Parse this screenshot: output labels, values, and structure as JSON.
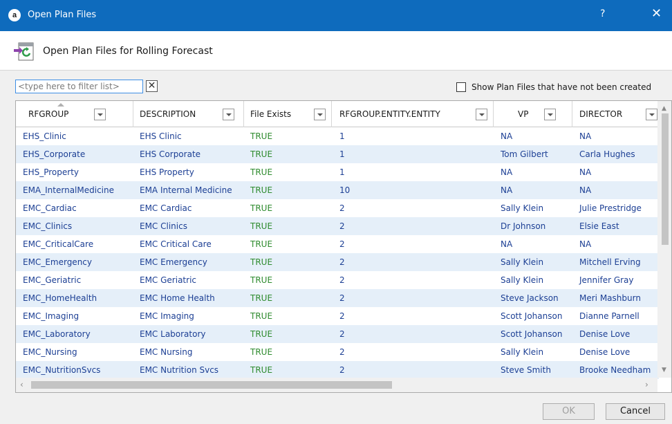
{
  "window": {
    "title": "Open Plan Files",
    "app_icon_glyph": "a",
    "help_label": "?",
    "close_label": "✕"
  },
  "header": {
    "title": "Open Plan Files for Rolling Forecast",
    "icon": "refresh-import-icon"
  },
  "filter": {
    "placeholder": "<type here to filter list>",
    "clear_label": "✕"
  },
  "show_uncreated": {
    "label": "Show Plan Files that have not been created",
    "checked": false
  },
  "grid": {
    "columns": [
      "RFGROUP",
      "DESCRIPTION",
      "File Exists",
      "RFGROUP.ENTITY.ENTITY",
      "VP",
      "DIRECTOR"
    ],
    "sorted_column": "RFGROUP",
    "rows": [
      [
        "EHS_Clinic",
        "EHS Clinic",
        "TRUE",
        "1",
        "NA",
        "NA"
      ],
      [
        "EHS_Corporate",
        "EHS Corporate",
        "TRUE",
        "1",
        "Tom Gilbert",
        "Carla Hughes"
      ],
      [
        "EHS_Property",
        "EHS Property",
        "TRUE",
        "1",
        "NA",
        "NA"
      ],
      [
        "EMA_InternalMedicine",
        "EMA Internal Medicine",
        "TRUE",
        "10",
        "NA",
        "NA"
      ],
      [
        "EMC_Cardiac",
        "EMC Cardiac",
        "TRUE",
        "2",
        "Sally Klein",
        "Julie Prestridge"
      ],
      [
        "EMC_Clinics",
        "EMC Clinics",
        "TRUE",
        "2",
        "Dr Johnson",
        "Elsie East"
      ],
      [
        "EMC_CriticalCare",
        "EMC Critical Care",
        "TRUE",
        "2",
        "NA",
        "NA"
      ],
      [
        "EMC_Emergency",
        "EMC Emergency",
        "TRUE",
        "2",
        "Sally Klein",
        "Mitchell Erving"
      ],
      [
        "EMC_Geriatric",
        "EMC Geriatric",
        "TRUE",
        "2",
        "Sally Klein",
        "Jennifer Gray"
      ],
      [
        "EMC_HomeHealth",
        "EMC Home Health",
        "TRUE",
        "2",
        "Steve Jackson",
        "Meri Mashburn"
      ],
      [
        "EMC_Imaging",
        "EMC Imaging",
        "TRUE",
        "2",
        "Scott Johanson",
        "Dianne Parnell"
      ],
      [
        "EMC_Laboratory",
        "EMC Laboratory",
        "TRUE",
        "2",
        "Scott Johanson",
        "Denise Love"
      ],
      [
        "EMC_Nursing",
        "EMC Nursing",
        "TRUE",
        "2",
        "Sally Klein",
        "Denise Love"
      ],
      [
        "EMC_NutritionSvcs",
        "EMC Nutrition Svcs",
        "TRUE",
        "2",
        "Steve Smith",
        "Brooke Needham"
      ]
    ]
  },
  "buttons": {
    "ok": "OK",
    "cancel": "Cancel"
  },
  "colors": {
    "titlebar": "#0e6bbd",
    "link_text": "#1c3f94",
    "true_text": "#2e8b2e",
    "alt_row": "#e5eff9"
  }
}
